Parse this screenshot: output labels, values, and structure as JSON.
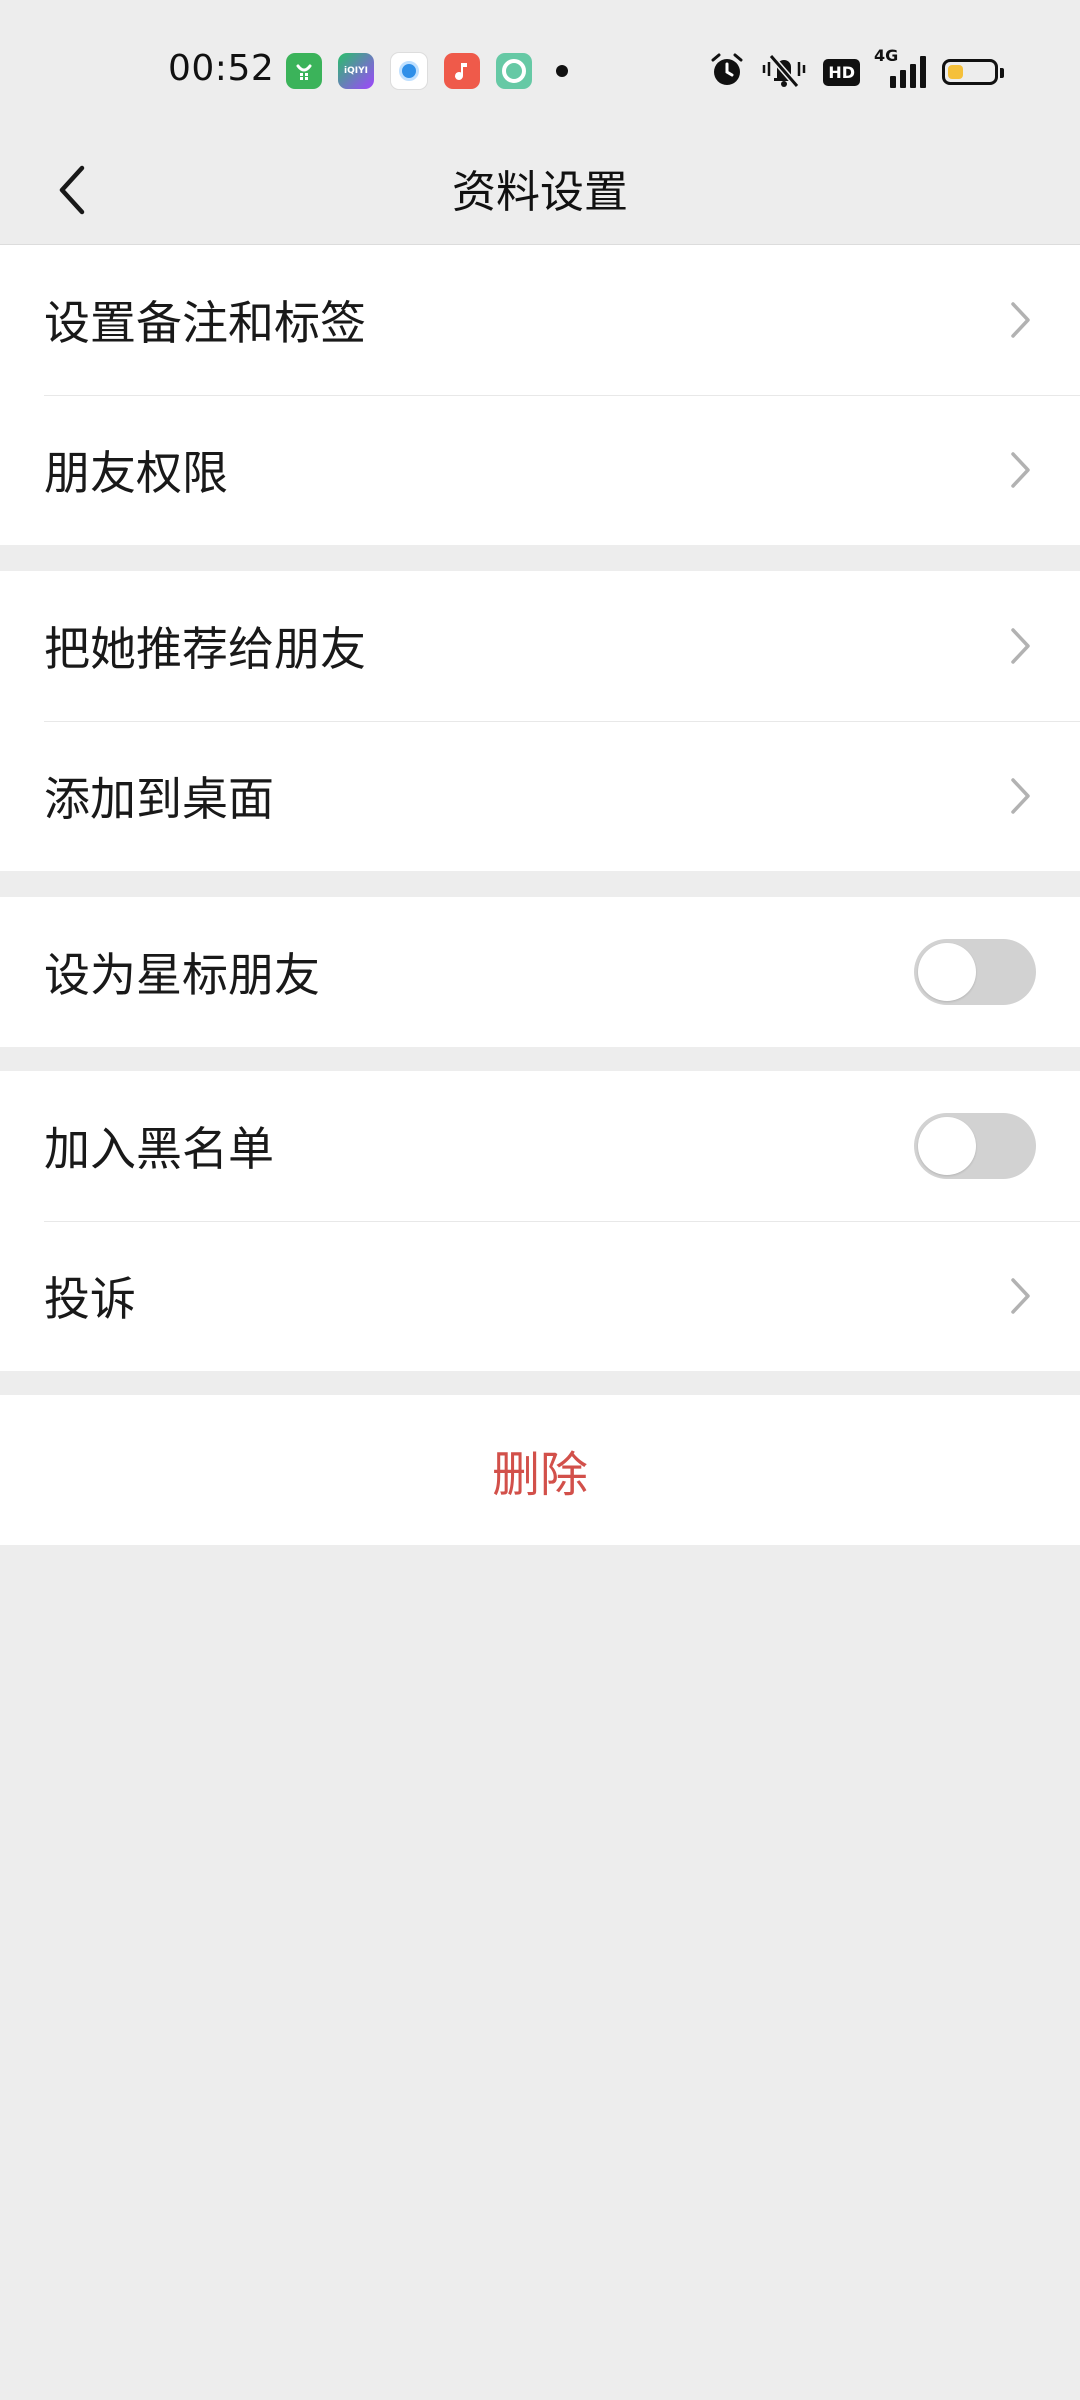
{
  "status_bar": {
    "time": "00:52",
    "app_icons": [
      "app-store-icon",
      "iqiyi-icon",
      "browser-icon",
      "music-icon",
      "camera-app-icon"
    ],
    "iqiyi_label": "iQIYI",
    "hd_label": "HD",
    "network_label": "4G",
    "battery_level": 0.35,
    "battery_color": "#f5c03a"
  },
  "header": {
    "title": "资料设置",
    "back_icon": "chevron-left-icon"
  },
  "groups": [
    {
      "items": [
        {
          "label": "设置备注和标签",
          "type": "link"
        },
        {
          "label": "朋友权限",
          "type": "link"
        }
      ]
    },
    {
      "items": [
        {
          "label": "把她推荐给朋友",
          "type": "link"
        },
        {
          "label": "添加到桌面",
          "type": "link"
        }
      ]
    },
    {
      "items": [
        {
          "label": "设为星标朋友",
          "type": "toggle",
          "value": false
        }
      ]
    },
    {
      "items": [
        {
          "label": "加入黑名单",
          "type": "toggle",
          "value": false
        },
        {
          "label": "投诉",
          "type": "link"
        }
      ]
    }
  ],
  "delete": {
    "label": "删除",
    "color": "#d2504a"
  }
}
